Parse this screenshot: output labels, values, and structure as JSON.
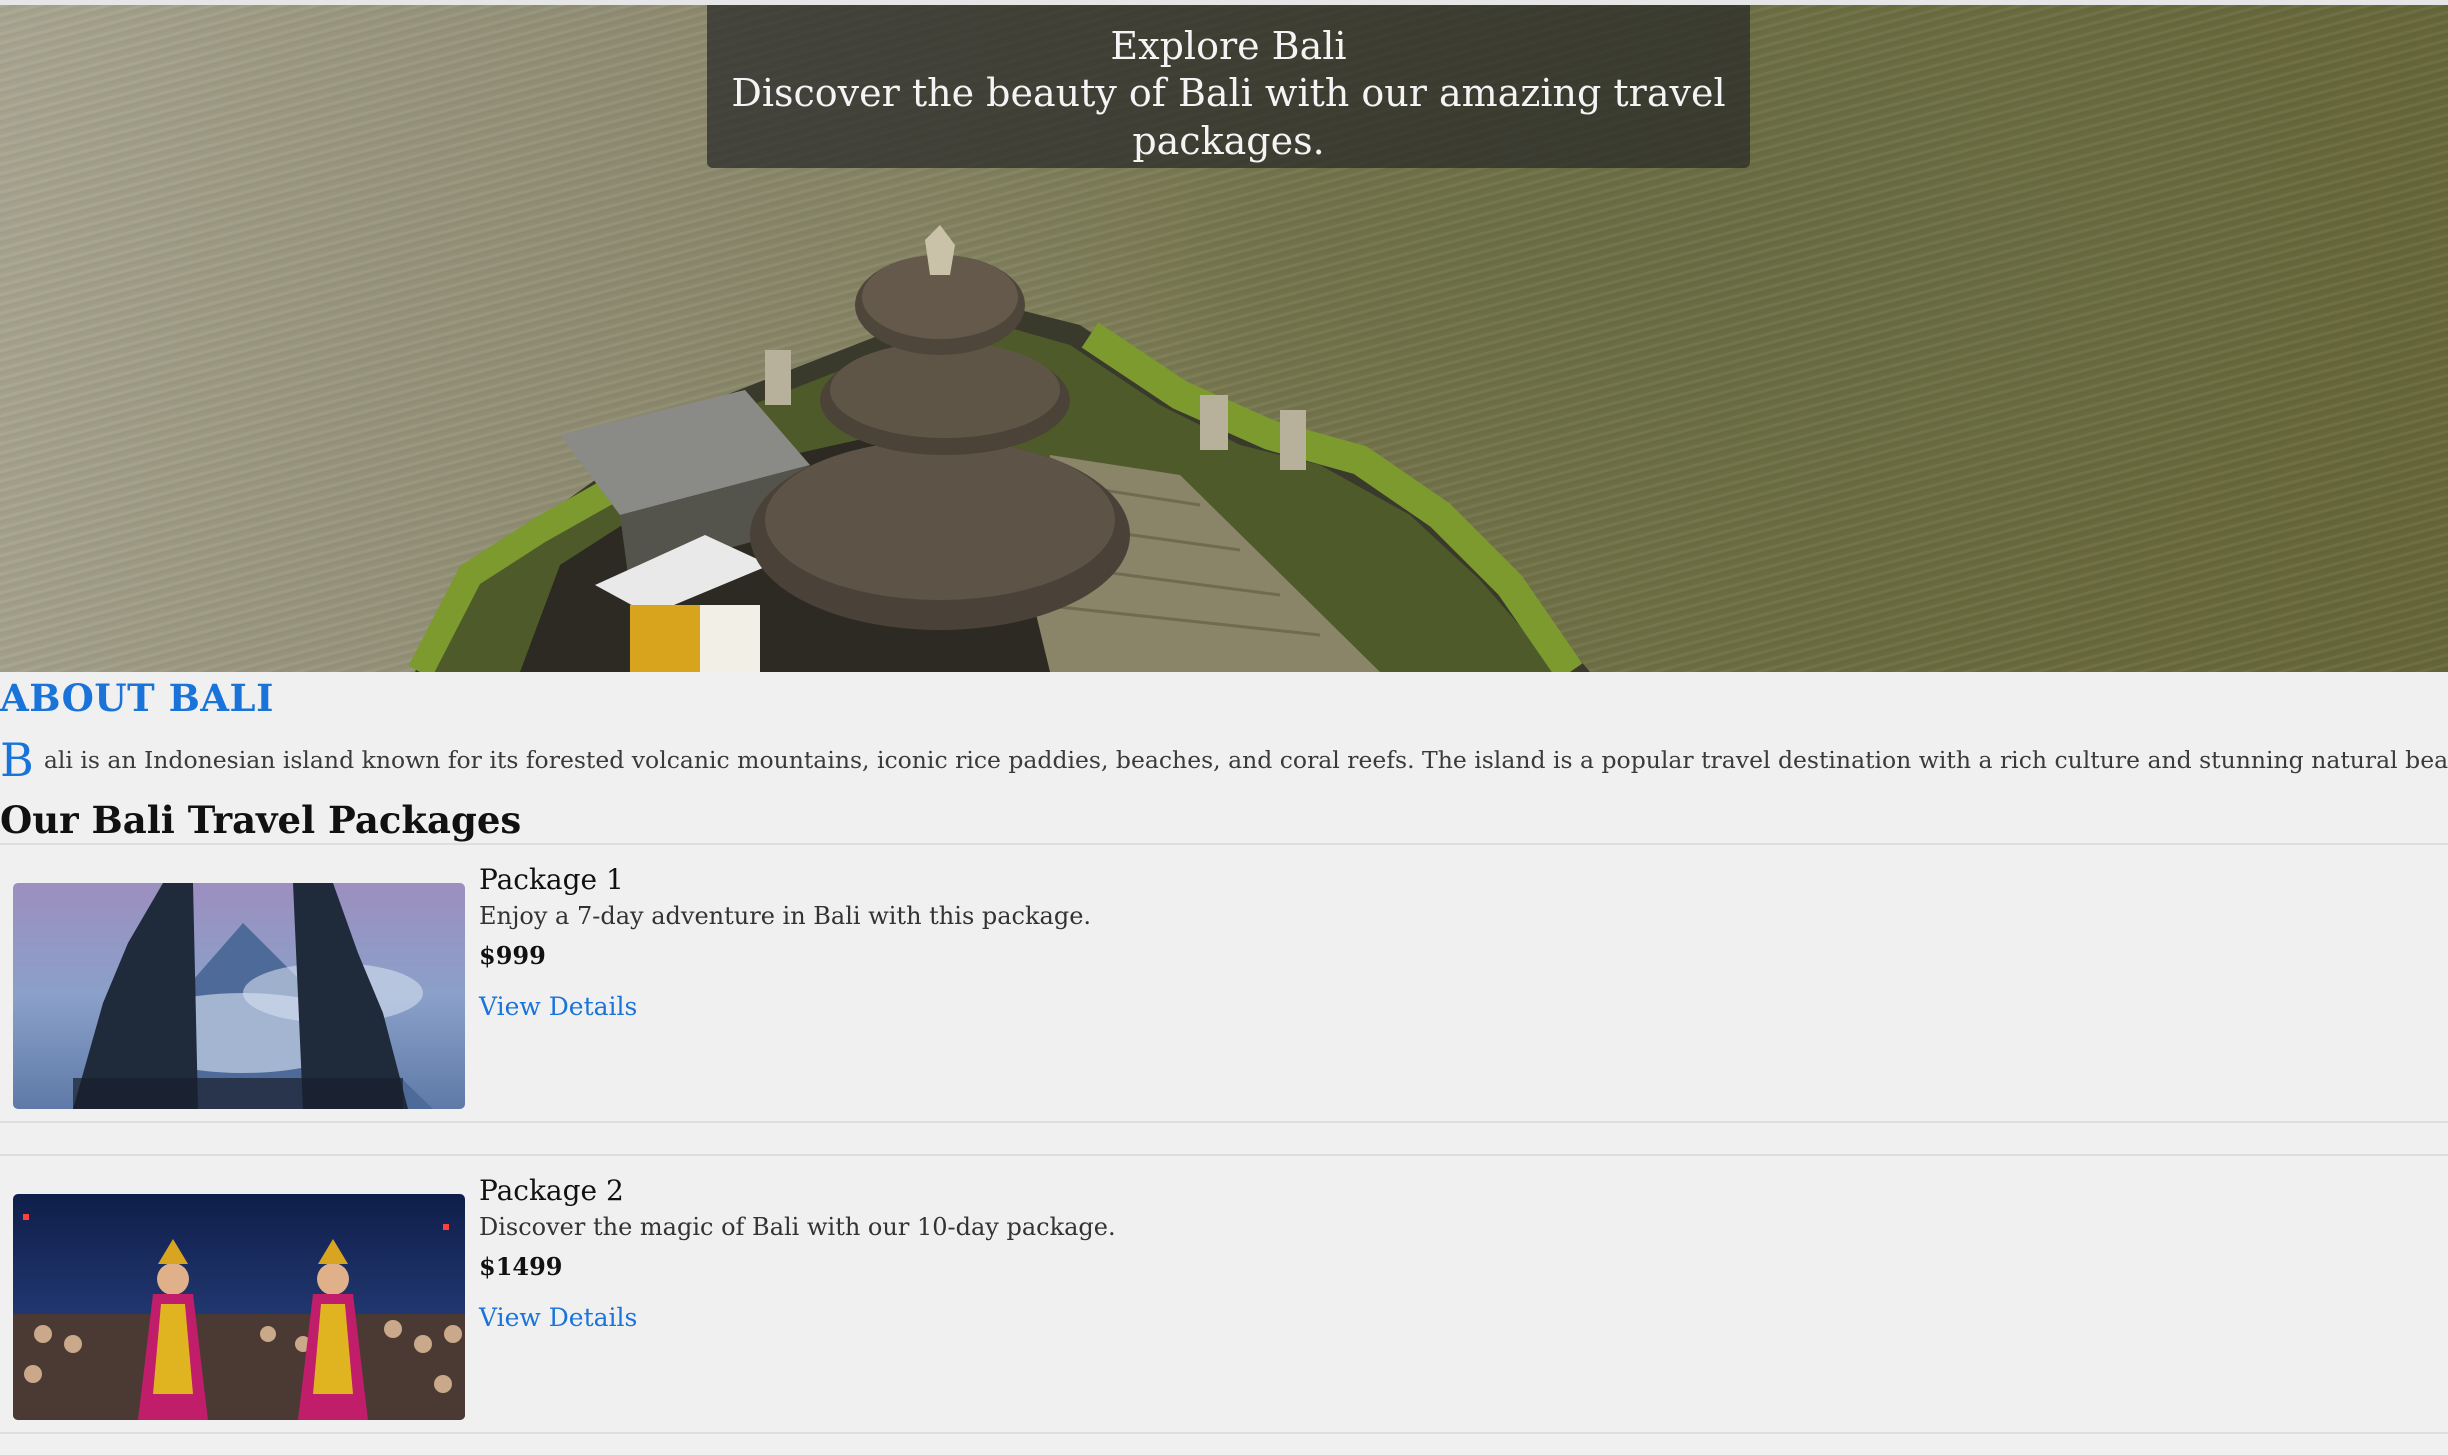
{
  "hero": {
    "title": "Explore Bali",
    "subtitle": "Discover the beauty of Bali with our amazing travel packages."
  },
  "about": {
    "heading": "ABOUT BALI",
    "dropcap": "B",
    "text": "ali is an Indonesian island known for its forested volcanic mountains, iconic rice paddies, beaches, and coral reefs. The island is a popular travel destination with a rich culture and stunning natural beauty."
  },
  "packages": {
    "heading": "Our Bali Travel Packages",
    "items": [
      {
        "name": "Package 1",
        "description": "Enjoy a 7-day adventure in Bali with this package.",
        "price": "$999",
        "link_label": "View Details"
      },
      {
        "name": "Package 2",
        "description": "Discover the magic of Bali with our 10-day package.",
        "price": "$1499",
        "link_label": "View Details"
      }
    ]
  },
  "colors": {
    "accent": "#1a73d9",
    "background": "#f0f0f0",
    "caption_overlay": "rgba(40,40,40,0.72)"
  }
}
